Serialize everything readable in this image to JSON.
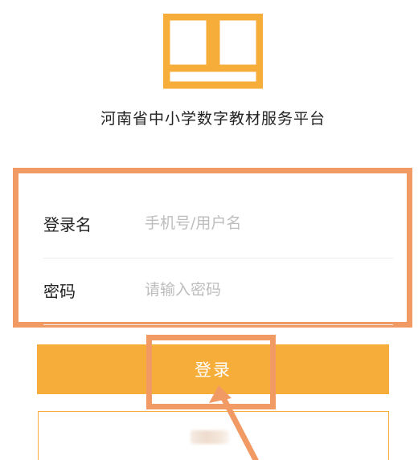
{
  "app": {
    "title": "河南省中小学数字教材服务平台"
  },
  "login_form": {
    "username_label": "登录名",
    "username_placeholder": "手机号/用户名",
    "username_value": "",
    "password_label": "密码",
    "password_placeholder": "请输入密码",
    "password_value": ""
  },
  "buttons": {
    "login_label": "登录"
  },
  "colors": {
    "brand": "#f6ad3a",
    "annotation": "#f29a63"
  },
  "icons": {
    "logo": "open-book-icon",
    "annotation_arrow": "arrow-up-left-icon"
  }
}
